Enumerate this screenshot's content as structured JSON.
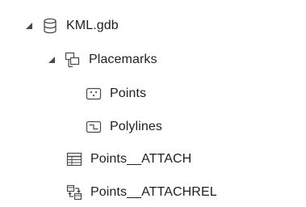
{
  "tree": {
    "root": {
      "label": "KML.gdb",
      "expanded": true,
      "icon": "geodatabase-icon",
      "children": {
        "placemarks": {
          "label": "Placemarks",
          "expanded": true,
          "icon": "feature-dataset-icon",
          "children": {
            "points": {
              "label": "Points",
              "icon": "point-feature-class-icon"
            },
            "polylines": {
              "label": "Polylines",
              "icon": "polyline-feature-class-icon"
            }
          }
        },
        "points_attach": {
          "label": "Points__ATTACH",
          "icon": "table-icon"
        },
        "points_attachrel": {
          "label": "Points__ATTACHREL",
          "icon": "relationship-class-icon"
        }
      }
    }
  },
  "colors": {
    "icon_stroke": "#4a4a4a",
    "text": "#1f1f1f",
    "background": "#ffffff"
  }
}
